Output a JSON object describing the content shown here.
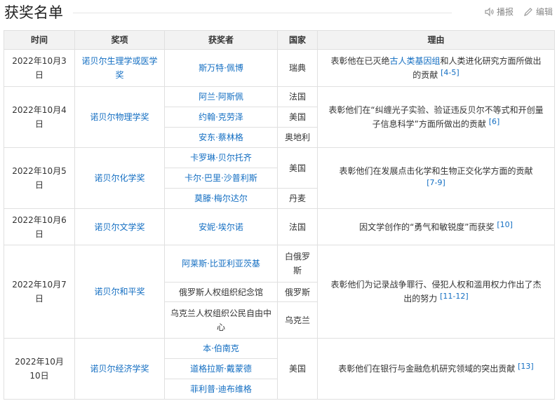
{
  "section": {
    "title": "获奖名单",
    "actions": {
      "play_label": "播报",
      "edit_label": "编辑"
    }
  },
  "table": {
    "headers": [
      "时间",
      "奖项",
      "获奖者",
      "国家",
      "理由"
    ],
    "rows": {
      "physiology": {
        "date": "2022年10月3日",
        "prize": "诺贝尔生理学或医学奖",
        "laureates": [
          "斯万特·佩博"
        ],
        "countries": [
          "瑞典"
        ],
        "reason_pre": "表彰他在已灭绝",
        "reason_link": "古人类基因组",
        "reason_post": "和人类进化研究方面所做出的贡献",
        "ref": "[4-5]"
      },
      "physics": {
        "date": "2022年10月4日",
        "prize": "诺贝尔物理学奖",
        "laureates": [
          "阿兰·阿斯佩",
          "约翰·克劳泽",
          "安东·蔡林格"
        ],
        "countries": [
          "法国",
          "美国",
          "奥地利"
        ],
        "reason": "表彰他们在“纠缠光子实验、验证违反贝尔不等式和开创量子信息科学”方面所做出的贡献",
        "ref": "[6]"
      },
      "chemistry": {
        "date": "2022年10月5日",
        "prize": "诺贝尔化学奖",
        "laureates": [
          "卡罗琳·贝尔托齐",
          "卡尔·巴里·沙普利斯",
          "莫滕·梅尔达尔"
        ],
        "countries": [
          "美国",
          "丹麦"
        ],
        "reason": "表彰他们在发展点击化学和生物正交化学方面的贡献",
        "ref": "[7-9]"
      },
      "literature": {
        "date": "2022年10月6日",
        "prize": "诺贝尔文学奖",
        "laureates": [
          "安妮·埃尔诺"
        ],
        "countries": [
          "法国"
        ],
        "reason": "因文学创作的“勇气和敏锐度”而获奖",
        "ref": "[10]"
      },
      "peace": {
        "date": "2022年10月7日",
        "prize": "诺贝尔和平奖",
        "laureates": [
          "阿莱斯·比亚利亚茨基",
          "俄罗斯人权组织纪念馆",
          "乌克兰人权组织公民自由中心"
        ],
        "countries": [
          "白俄罗斯",
          "俄罗斯",
          "乌克兰"
        ],
        "reason": "表彰他们为记录战争罪行、侵犯人权和滥用权力作出了杰出的努力",
        "ref": "[11-12]"
      },
      "economics": {
        "date": "2022年10月10日",
        "prize": "诺贝尔经济学奖",
        "laureates": [
          "本·伯南克",
          "道格拉斯·戴蒙德",
          "菲利普·迪布维格"
        ],
        "countries": [
          "美国"
        ],
        "reason": "表彰他们在银行与金融危机研究领域的突出贡献",
        "ref": "[13]"
      }
    }
  }
}
